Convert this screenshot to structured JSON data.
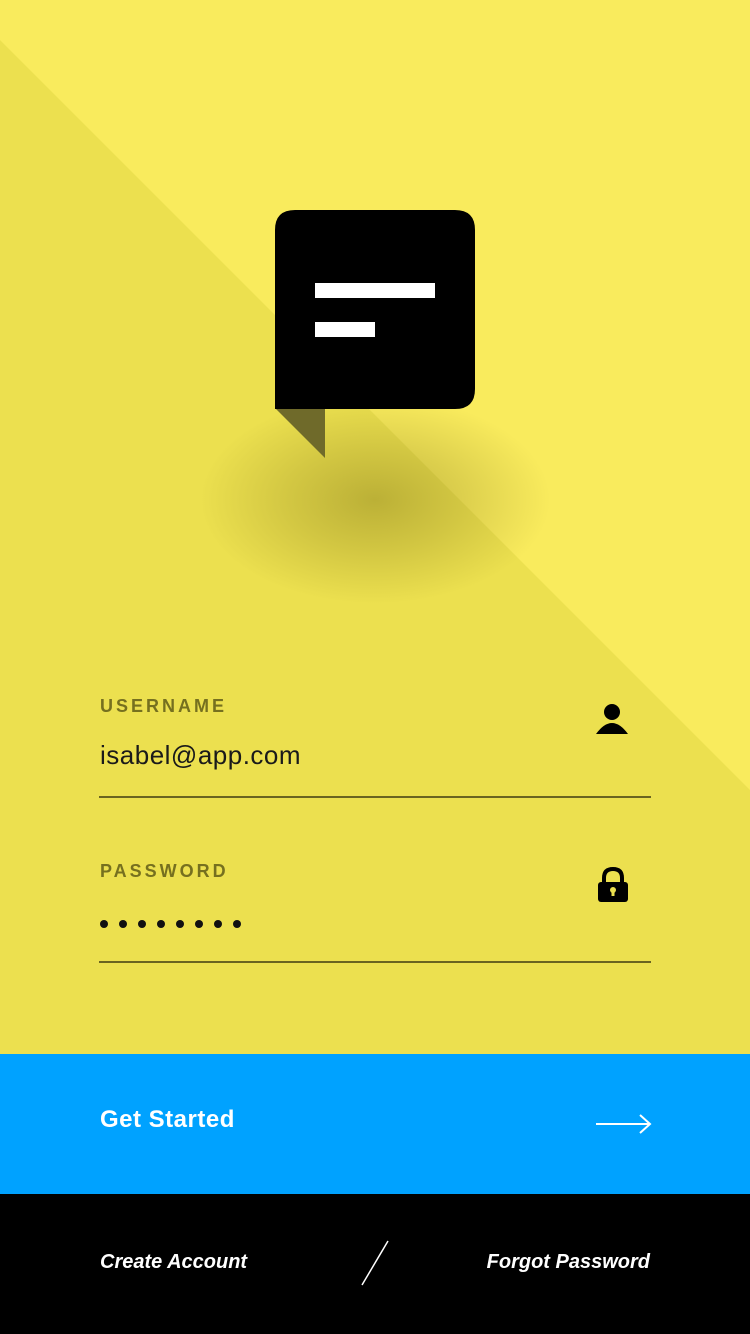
{
  "colors": {
    "background_light": "#f9eb5d",
    "background_dark": "#ece04f",
    "accent_blue": "#00a2ff",
    "footer_black": "#000000",
    "label_olive": "#76701f"
  },
  "logo": {
    "icon": "chat-bubble-icon"
  },
  "username": {
    "label": "USERNAME",
    "value": "isabel@app.com",
    "icon": "user-icon"
  },
  "password": {
    "label": "PASSWORD",
    "masked_length": 8,
    "icon": "lock-icon"
  },
  "cta": {
    "label": "Get Started",
    "icon": "arrow-right-icon"
  },
  "footer": {
    "create_account": "Create Account",
    "forgot_password": "Forgot Password"
  }
}
